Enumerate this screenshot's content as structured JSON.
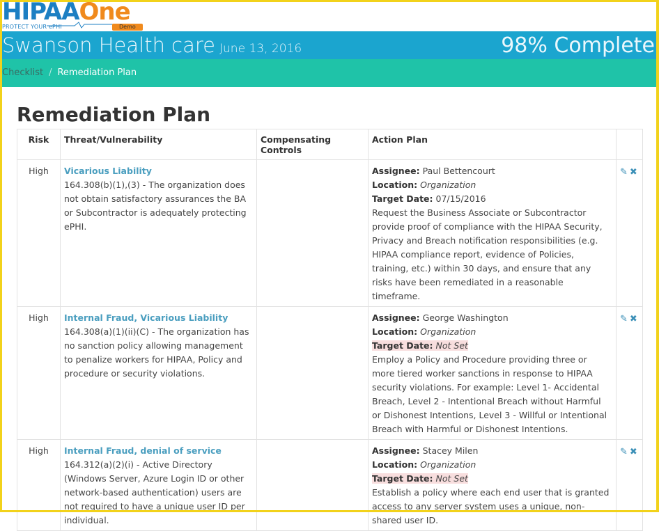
{
  "logo": {
    "brand_left": "HIPAA",
    "brand_right": "One",
    "tagline": "PROTECT YOUR ePHI",
    "badge": "Demo"
  },
  "header": {
    "organization": "Swanson Health care",
    "date": "June 13, 2016",
    "progress_text": "98% Complete"
  },
  "breadcrumb": {
    "items": [
      "Checklist",
      "Remediation Plan"
    ],
    "separator": "/"
  },
  "page_title": "Remediation Plan",
  "table": {
    "headers": {
      "risk": "Risk",
      "threat": "Threat/Vulnerability",
      "controls": "Compensating Controls",
      "action": "Action Plan"
    },
    "labels": {
      "assignee": "Assignee:",
      "location": "Location:",
      "target_date": "Target Date:"
    },
    "rows": [
      {
        "risk": "High",
        "threat_title": "Vicarious Liability",
        "threat_desc": "164.308(b)(1),(3) - The organization does not obtain satisfactory assurances the BA or Subcontractor is adequately protecting ePHI.",
        "controls": "",
        "assignee": "Paul Bettencourt",
        "location": "Organization",
        "target_date": "07/15/2016",
        "plan": "Request the Business Associate or Subcontractor provide proof of compliance with the HIPAA Security, Privacy and Breach notification responsibilities (e.g. HIPAA compliance report, evidence of Policies, training, etc.) within 30 days, and ensure that any risks have been remediated in a reasonable timeframe."
      },
      {
        "risk": "High",
        "threat_title": "Internal Fraud, Vicarious Liability",
        "threat_desc": "164.308(a)(1)(ii)(C) - The organization has no sanction policy allowing management to penalize workers for HIPAA, Policy and procedure or security violations.",
        "controls": "",
        "assignee": "George Washington",
        "location": "Organization",
        "target_date": "Not Set",
        "plan": "Employ a Policy and Procedure providing three or more tiered worker sanctions in response to HIPAA security violations. For example: Level 1- Accidental Breach, Level 2 - Intentional Breach without Harmful or Dishonest Intentions, Level 3 - Willful or Intentional Breach with Harmful or Dishonest Intentions."
      },
      {
        "risk": "High",
        "threat_title": "Internal Fraud, denial of service",
        "threat_desc": "164.312(a)(2)(i) - Active Directory (Windows Server, Azure Login ID or other network-based authentication) users are not required to have a unique user ID per individual.",
        "controls": "",
        "assignee": "Stacey Milen",
        "location": "Organization",
        "target_date": "Not Set",
        "plan": "Establish a policy where each end user that is granted access to any server system uses a unique, non-shared user ID."
      }
    ]
  },
  "colors": {
    "header_blue": "#1ba5cf",
    "breadcrumb_teal": "#1fc3a8",
    "frame_yellow": "#f2d21b",
    "link_blue": "#4a9ebf",
    "notset_bg": "#f8dede"
  }
}
